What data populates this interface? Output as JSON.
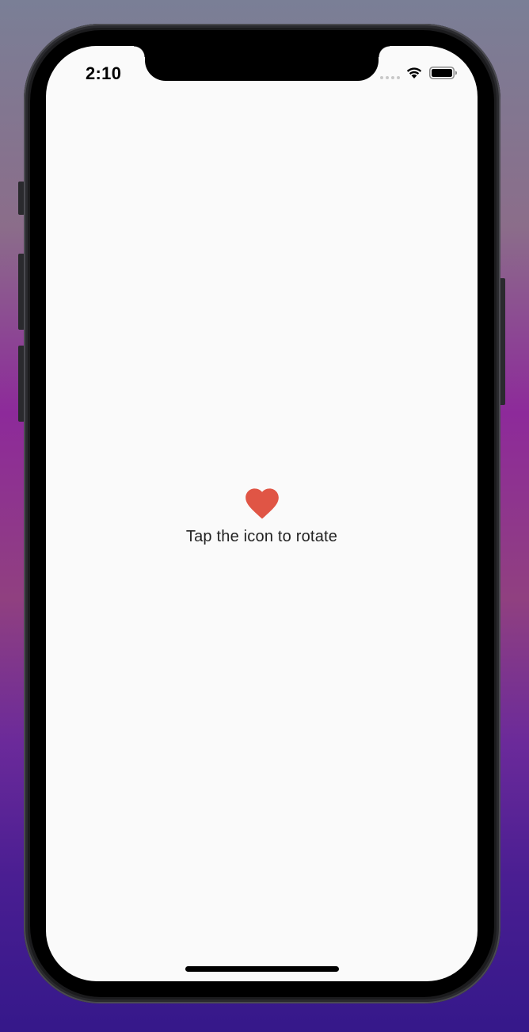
{
  "status_bar": {
    "time": "2:10",
    "wifi_icon": "wifi-icon",
    "battery_icon": "battery-icon"
  },
  "main": {
    "icon": "heart-icon",
    "icon_color": "#e05545",
    "hint": "Tap the icon to rotate"
  },
  "colors": {
    "screen_background": "#fafafa",
    "text": "#222222"
  }
}
